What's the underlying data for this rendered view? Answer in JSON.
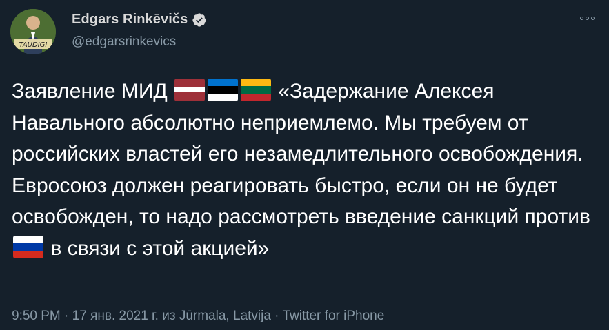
{
  "author": {
    "display_name": "Edgars Rinkēvičs",
    "handle": "@edgarsrinkevics",
    "avatar_caption": "TAUDIGI",
    "verified": true
  },
  "tweet": {
    "segment_1": "Заявление МИД ",
    "flags_1": [
      "latvia-flag",
      "estonia-flag",
      "lithuania-flag"
    ],
    "segment_2": " «Задержание Алексея Навального абсолютно неприемлемо. Мы требуем от российских властей его незамедлительного освобождения. Евросоюз должен реагировать быстро, если он не будет освобожден, то надо рассмотреть введение санкций против ",
    "flags_2": [
      "russia-flag"
    ],
    "segment_3": " в связи с этой акцией»"
  },
  "meta": {
    "time": "9:50 PM",
    "separator": " · ",
    "date": "17 янв. 2021 г.",
    "location_prefix": " из ",
    "location": "Jūrmala, Latvija",
    "source": "Twitter for iPhone"
  },
  "colors": {
    "background": "#15202b",
    "text": "#ffffff",
    "secondary": "#8899a6",
    "name": "#d9d9d9"
  }
}
